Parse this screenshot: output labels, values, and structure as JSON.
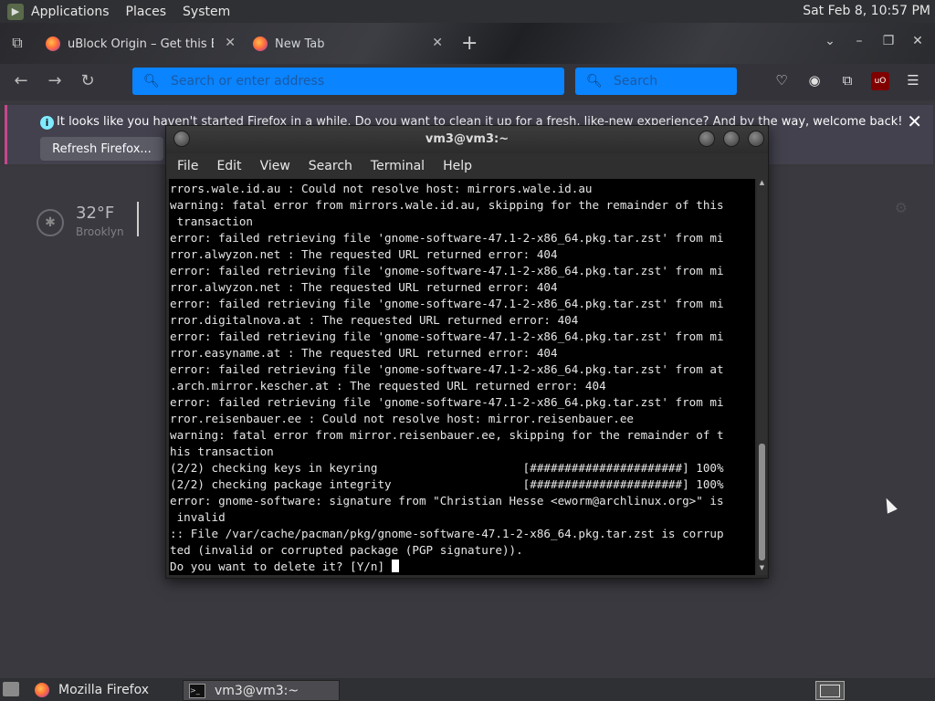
{
  "top_panel": {
    "menus": [
      "Applications",
      "Places",
      "System"
    ],
    "clock": "Sat Feb  8, 10:57 PM"
  },
  "firefox": {
    "tabs": [
      {
        "label": "uBlock Origin – Get this Ext",
        "favicon": "firefox-icon"
      },
      {
        "label": "New Tab",
        "favicon": "firefox-icon"
      }
    ],
    "address_placeholder": "Search or enter address",
    "search_placeholder": "Search",
    "notice": {
      "text": "It looks like you haven't started Firefox in a while. Do you want to clean it up for a fresh, like-new experience? And by the way, welcome back!",
      "button": "Refresh Firefox..."
    },
    "weather": {
      "temp": "32°F",
      "city": "Brooklyn"
    },
    "accent_color": "#0a84ff"
  },
  "terminal": {
    "title": "vm3@vm3:~",
    "menu": [
      "File",
      "Edit",
      "View",
      "Search",
      "Terminal",
      "Help"
    ],
    "lines": [
      "rrors.wale.id.au : Could not resolve host: mirrors.wale.id.au",
      "warning: fatal error from mirrors.wale.id.au, skipping for the remainder of this",
      " transaction",
      "error: failed retrieving file 'gnome-software-47.1-2-x86_64.pkg.tar.zst' from mi",
      "rror.alwyzon.net : The requested URL returned error: 404",
      "error: failed retrieving file 'gnome-software-47.1-2-x86_64.pkg.tar.zst' from mi",
      "rror.alwyzon.net : The requested URL returned error: 404",
      "error: failed retrieving file 'gnome-software-47.1-2-x86_64.pkg.tar.zst' from mi",
      "rror.digitalnova.at : The requested URL returned error: 404",
      "error: failed retrieving file 'gnome-software-47.1-2-x86_64.pkg.tar.zst' from mi",
      "rror.easyname.at : The requested URL returned error: 404",
      "error: failed retrieving file 'gnome-software-47.1-2-x86_64.pkg.tar.zst' from at",
      ".arch.mirror.kescher.at : The requested URL returned error: 404",
      "error: failed retrieving file 'gnome-software-47.1-2-x86_64.pkg.tar.zst' from mi",
      "rror.reisenbauer.ee : Could not resolve host: mirror.reisenbauer.ee",
      "warning: fatal error from mirror.reisenbauer.ee, skipping for the remainder of t",
      "his transaction",
      "(2/2) checking keys in keyring                     [######################] 100%",
      "(2/2) checking package integrity                   [######################] 100%",
      "error: gnome-software: signature from \"Christian Hesse <eworm@archlinux.org>\" is",
      " invalid",
      ":: File /var/cache/pacman/pkg/gnome-software-47.1-2-x86_64.pkg.tar.zst is corrup",
      "ted (invalid or corrupted package (PGP signature)).",
      "Do you want to delete it? [Y/n] "
    ]
  },
  "taskbar": {
    "tasks": [
      {
        "label": "Mozilla Firefox",
        "icon": "firefox-icon"
      },
      {
        "label": "vm3@vm3:~",
        "icon": "terminal-icon"
      }
    ]
  }
}
